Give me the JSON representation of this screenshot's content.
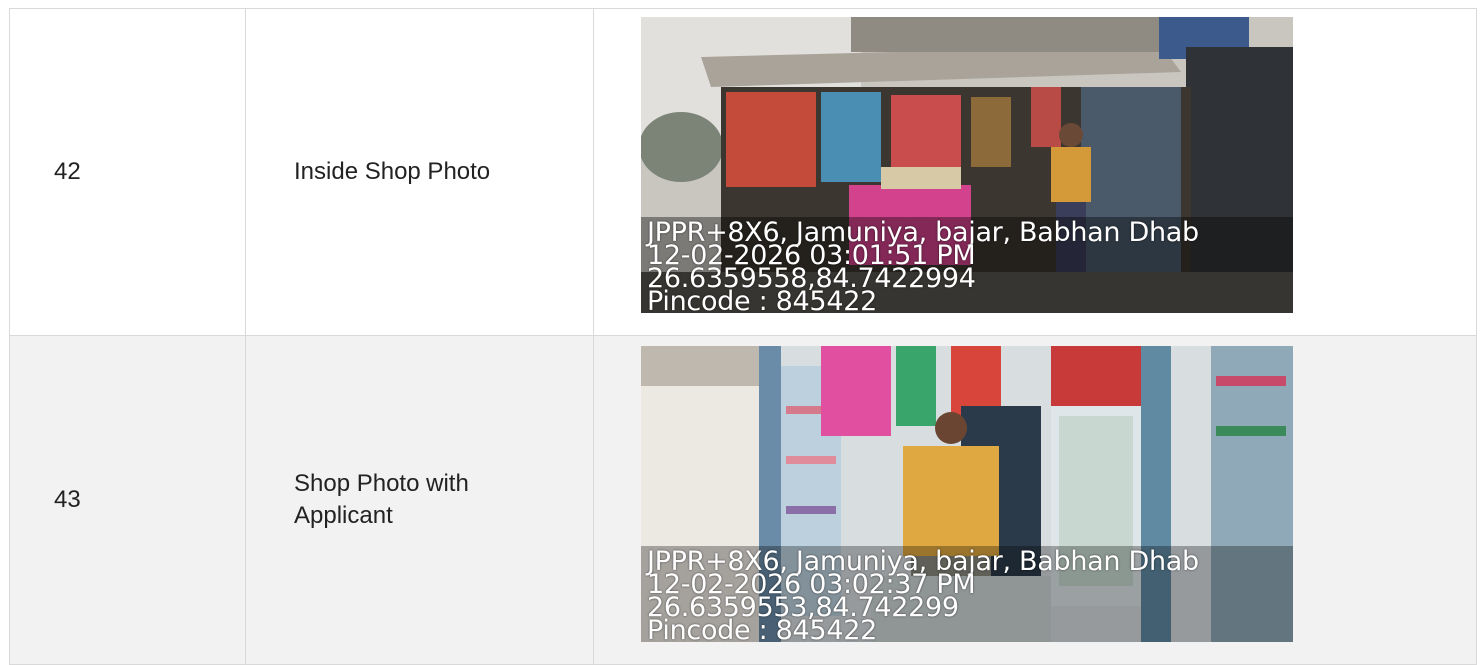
{
  "rows": [
    {
      "number": "42",
      "label": "Inside Shop Photo",
      "stamp": {
        "line1": "JPPR+8X6, Jamuniya, bajar, Babhan Dhab",
        "line2": "12-02-2026 03:01:51 PM",
        "line3": "26.6359558,84.7422994",
        "line4": "Pincode : 845422"
      }
    },
    {
      "number": "43",
      "label": "Shop Photo with Applicant",
      "stamp": {
        "line1": "JPPR+8X6, Jamuniya, bajar, Babhan Dhab",
        "line2": "12-02-2026 03:02:37 PM",
        "line3": "26.6359553,84.742299",
        "line4": "Pincode : 845422"
      }
    }
  ],
  "colors": {
    "border": "#d9d9d9",
    "row_alt_bg": "#f2f2f2",
    "text": "#222222"
  }
}
